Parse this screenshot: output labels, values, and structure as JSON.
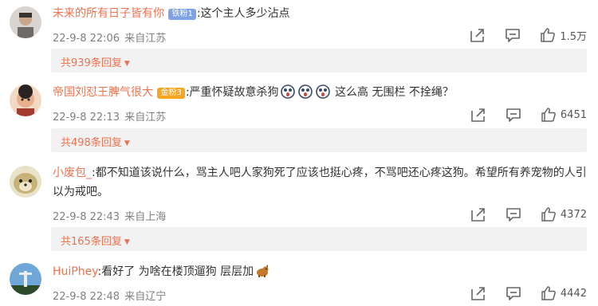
{
  "comments": [
    {
      "username": "未来的所有日子皆有你",
      "badge": "铁粉1",
      "text": ":这个主人多少沾点",
      "date": "22-9-8 22:06",
      "location": "来自江苏",
      "likes": "1.5万",
      "replies": "共939条回复"
    },
    {
      "username": "帝国刘怼王脾气很大",
      "badge": "金粉3",
      "text_before": ":严重怀疑故意杀狗",
      "emojis": [
        "shocked-emoji",
        "shocked-emoji",
        "shocked-emoji"
      ],
      "text_after": " 这么高 无围栏 不拴绳？",
      "date": "22-9-8 22:13",
      "location": "来自江苏",
      "likes": "6451",
      "replies": "共498条回复"
    },
    {
      "username": "小废包_",
      "text": ":都不知道该说什么，骂主人吧人家狗死了应该也挺心疼，不骂吧还心疼这狗。希望所有养宠物的人引以为戒吧。",
      "date": "22-9-8 22:43",
      "location": "来自上海",
      "likes": "4372",
      "replies": "共165条回复"
    },
    {
      "username": "HuiPhey",
      "text": ":看好了 为啥在楼顶遛狗 层层加",
      "emojis": [
        "dog-emoji"
      ],
      "date": "22-9-8 22:48",
      "location": "来自辽宁",
      "likes": "4442"
    }
  ],
  "colors": {
    "username": "#eb7350",
    "meta": "#808080",
    "reply_bg": "#f2f2f2"
  }
}
